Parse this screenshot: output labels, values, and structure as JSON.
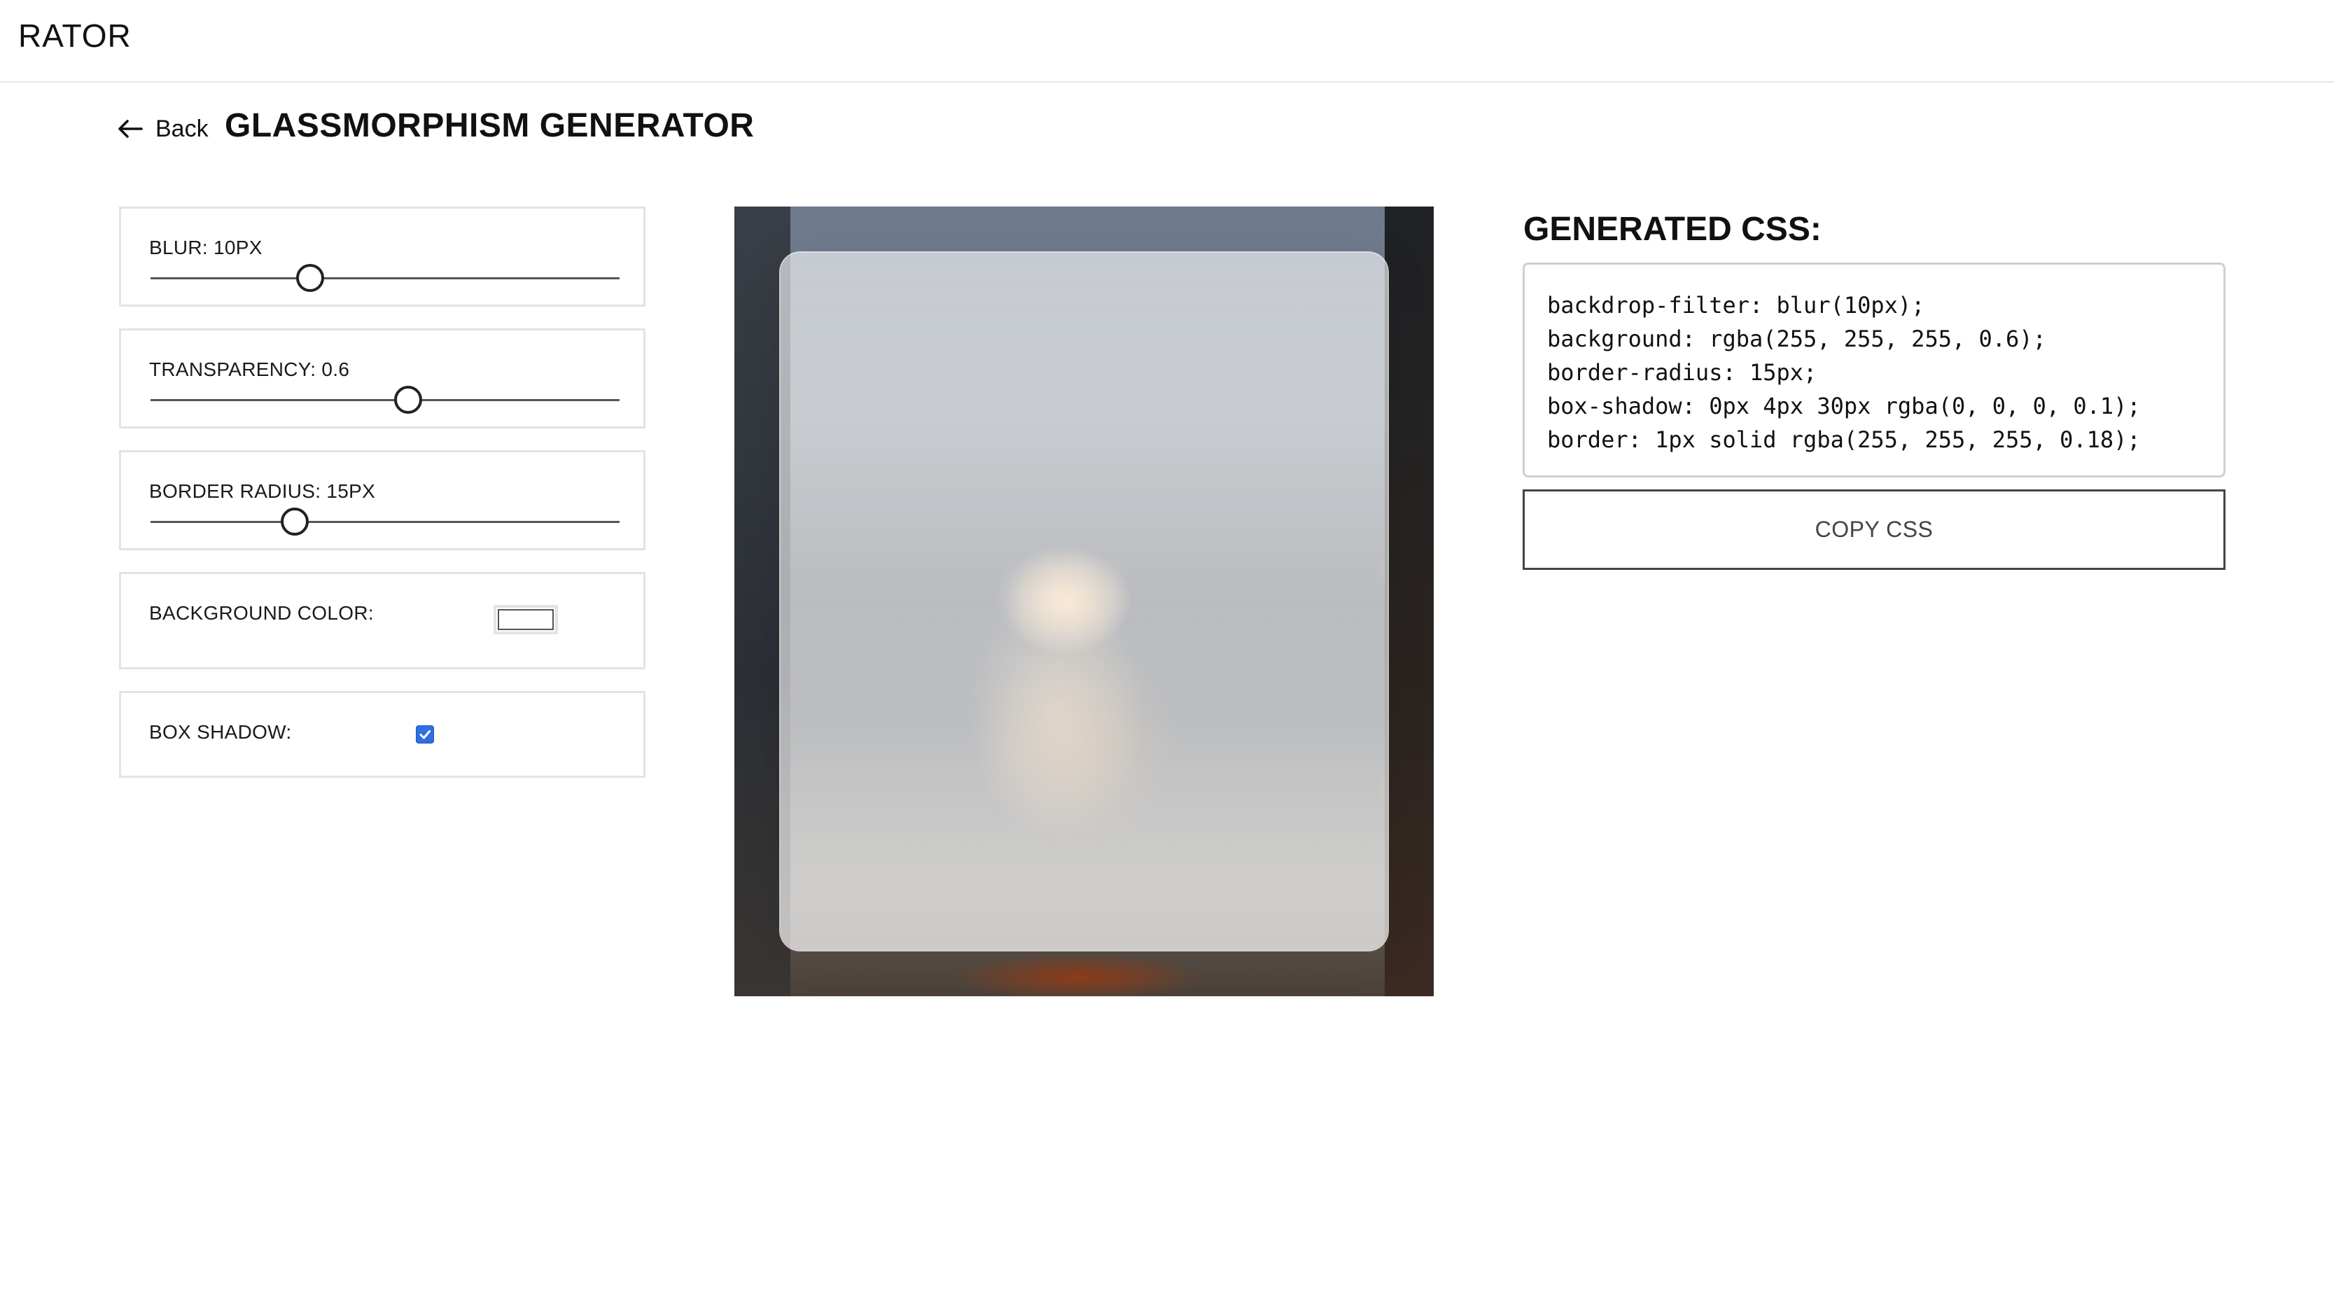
{
  "app": {
    "brand": "RATOR"
  },
  "header": {
    "back_label": "Back",
    "title": "GLASSMORPHISM GENERATOR"
  },
  "controls": {
    "blur": {
      "label": "BLUR: 10PX",
      "value": 10
    },
    "transparency": {
      "label": "TRANSPARENCY: 0.6",
      "value": 0.6
    },
    "border_radius": {
      "label": "BORDER RADIUS: 15PX",
      "value": 15
    },
    "background_color": {
      "label": "BACKGROUND COLOR:",
      "value": "#ffffff"
    },
    "box_shadow": {
      "label": "BOX SHADOW:",
      "checked": true
    }
  },
  "output": {
    "title": "GENERATED CSS:",
    "css_lines": [
      "backdrop-filter: blur(10px);",
      "background: rgba(255, 255, 255, 0.6);",
      "border-radius: 15px;",
      "box-shadow: 0px 4px 30px rgba(0, 0, 0, 0.1);",
      "border: 1px solid rgba(255, 255, 255, 0.18);"
    ],
    "copy_label": "COPY CSS"
  },
  "colors": {
    "accent": "#2f6fe0",
    "text": "#111111",
    "border": "#e3e3e3"
  }
}
